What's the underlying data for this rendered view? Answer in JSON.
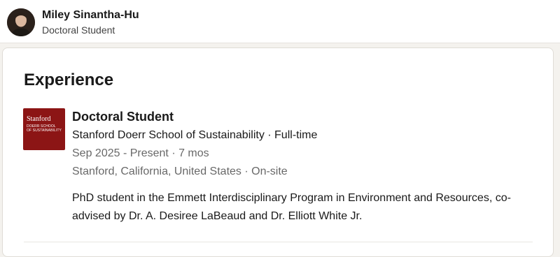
{
  "profile": {
    "name": "Miley Sinantha-Hu",
    "headline": "Doctoral Student"
  },
  "experience": {
    "section_title": "Experience",
    "entries": [
      {
        "logo": {
          "main": "Stanford",
          "sub_line1": "DOERR SCHOOL",
          "sub_line2": "OF SUSTAINABILITY",
          "color": "#8c1515"
        },
        "title": "Doctoral Student",
        "company_line": "Stanford Doerr School of Sustainability · Full-time",
        "dates": "Sep 2025 - Present · 7 mos",
        "location": "Stanford, California, United States · On-site",
        "description": "PhD student in the Emmett Interdisciplinary Program in Environment and Resources, co-advised by Dr. A. Desiree LaBeaud and Dr. Elliott White Jr."
      }
    ]
  }
}
